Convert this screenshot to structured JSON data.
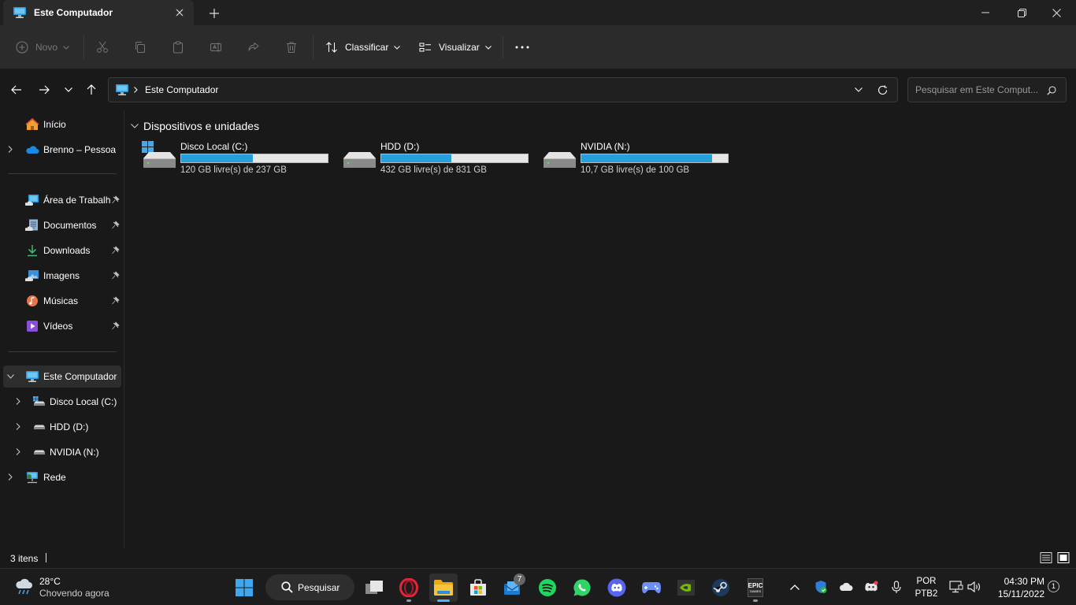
{
  "window": {
    "tab_title": "Este Computador"
  },
  "toolbar": {
    "new_label": "Novo",
    "sort_label": "Classificar",
    "view_label": "Visualizar"
  },
  "address": {
    "location": "Este Computador",
    "search_placeholder": "Pesquisar em Este Comput..."
  },
  "sidebar": {
    "home": "Início",
    "onedrive": "Brenno – Pessoal",
    "quick": [
      "Área de Trabalho",
      "Documentos",
      "Downloads",
      "Imagens",
      "Músicas",
      "Vídeos"
    ],
    "this_pc": "Este Computador",
    "drives": [
      "Disco Local (C:)",
      "HDD (D:)",
      "NVIDIA (N:)"
    ],
    "network": "Rede"
  },
  "main": {
    "group_title": "Dispositivos e unidades",
    "drives": [
      {
        "name": "Disco Local (C:)",
        "free_text": "120 GB livre(s) de 237 GB",
        "used_fraction": 0.49
      },
      {
        "name": "HDD (D:)",
        "free_text": "432 GB livre(s) de 831 GB",
        "used_fraction": 0.48
      },
      {
        "name": "NVIDIA (N:)",
        "free_text": "10,7 GB livre(s) de 100 GB",
        "used_fraction": 0.89
      }
    ]
  },
  "status": {
    "items_count": "3 itens"
  },
  "taskbar": {
    "weather_temp": "28°C",
    "weather_desc": "Chovendo agora",
    "search_label": "Pesquisar",
    "mail_badge": "7",
    "epic_label": "EPIC",
    "epic_sub": "GAMES",
    "lang": "POR",
    "layout": "PTB2",
    "time": "04:30 PM",
    "date": "15/11/2022",
    "notifications": "1"
  },
  "colors": {
    "accent": "#26a0da",
    "folder": "#f8c43a"
  }
}
